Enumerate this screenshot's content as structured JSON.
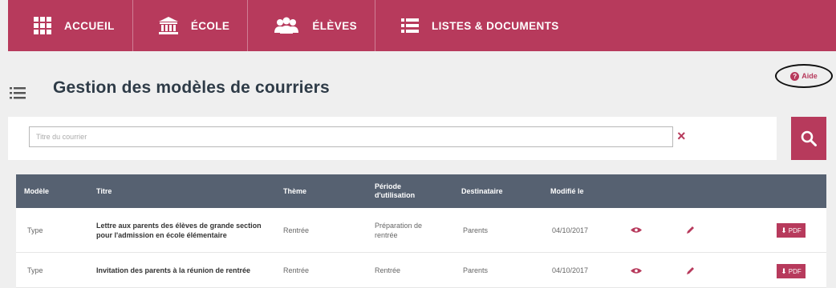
{
  "nav": {
    "items": [
      {
        "label": "ACCUEIL",
        "icon": "grid-icon"
      },
      {
        "label": "ÉCOLE",
        "icon": "school-building-icon"
      },
      {
        "label": "ÉLÈVES",
        "icon": "students-icon"
      },
      {
        "label": "LISTES & DOCUMENTS",
        "icon": "list-icon"
      }
    ]
  },
  "page": {
    "title": "Gestion des modèles de courriers",
    "help_label": "Aide"
  },
  "search": {
    "placeholder": "Titre du courrier",
    "clear_label": "×"
  },
  "table": {
    "headers": {
      "modele": "Modèle",
      "titre": "Titre",
      "theme": "Thème",
      "periode_line1": "Période",
      "periode_line2": "d'utilisation",
      "destinataire": "Destinataire",
      "modifie": "Modifié le"
    },
    "rows": [
      {
        "modele": "Type",
        "titre": "Lettre aux parents des élèves de grande section pour l'admission en école élémentaire",
        "theme": "Rentrée",
        "periode": "Préparation de rentrée",
        "destinataire": "Parents",
        "modifie": "04/10/2017",
        "pdf_label": "PDF"
      },
      {
        "modele": "Type",
        "titre": "Invitation des parents à la réunion de rentrée",
        "theme": "Rentrée",
        "periode": "Rentrée",
        "destinataire": "Parents",
        "modifie": "04/10/2017",
        "pdf_label": "PDF"
      }
    ]
  },
  "colors": {
    "brand": "#b73a5c",
    "table_header": "#566171",
    "background": "#efefef"
  }
}
